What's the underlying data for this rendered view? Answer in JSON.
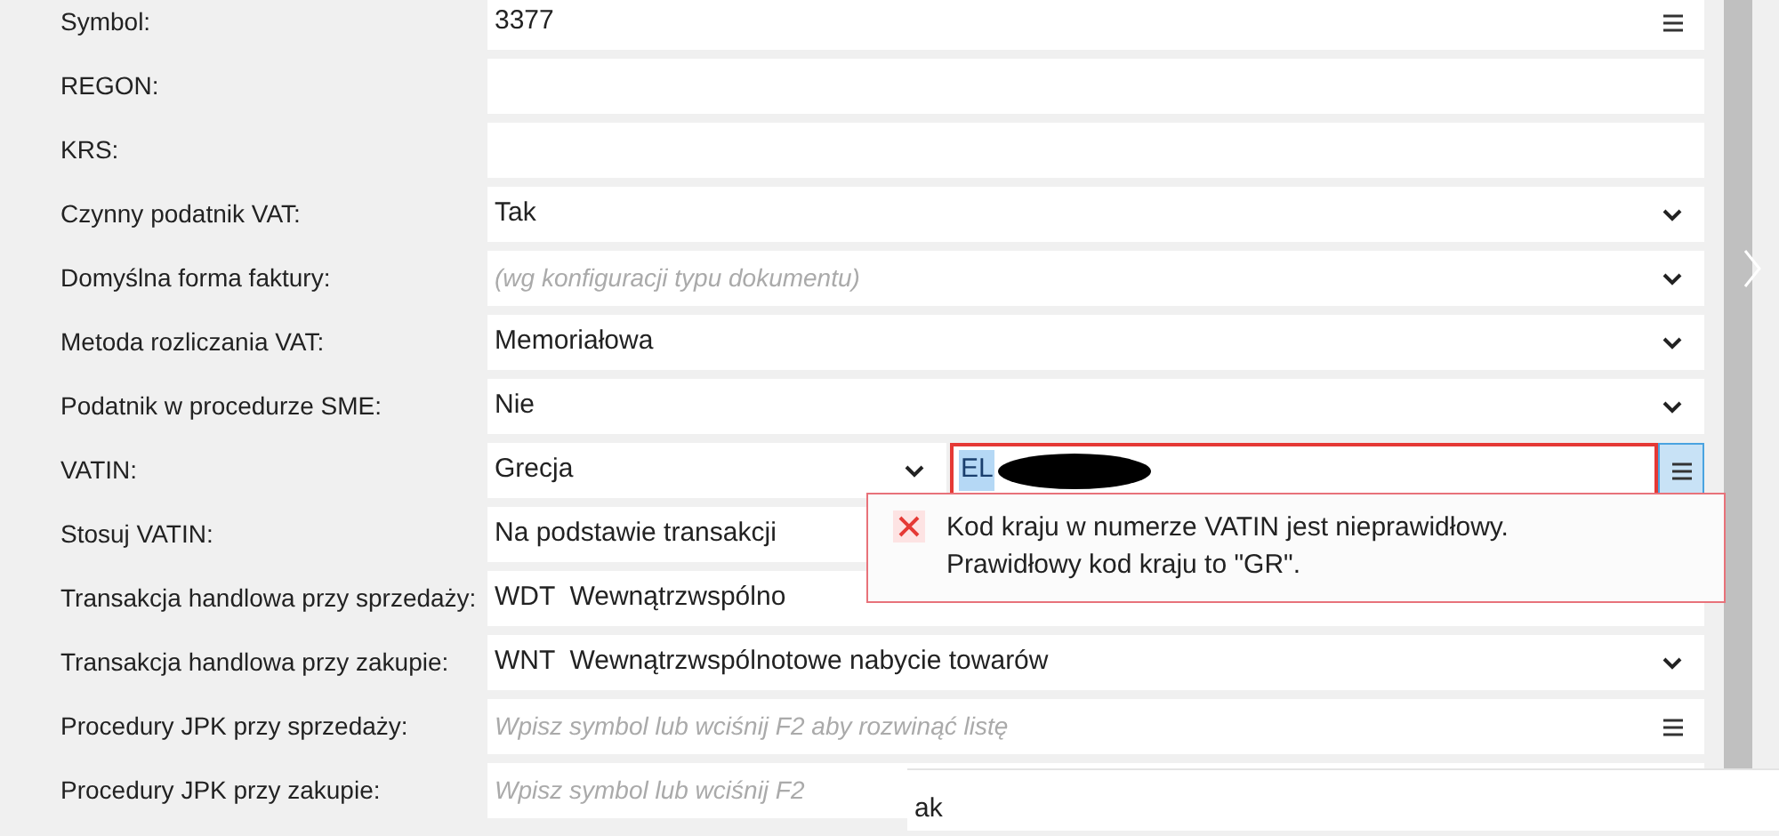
{
  "fields": [
    {
      "label": "Symbol:",
      "kind": "lookup",
      "value": "3377"
    },
    {
      "label": "REGON:",
      "kind": "text"
    },
    {
      "label": "KRS:",
      "kind": "text"
    },
    {
      "label": "Czynny podatnik VAT:",
      "kind": "select",
      "value": "Tak"
    },
    {
      "label": "Domyślna forma faktury:",
      "kind": "select",
      "placeholder": "(wg konfiguracji typu dokumentu)"
    },
    {
      "label": "Metoda rozliczania VAT:",
      "kind": "select",
      "value": "Memoriałowa"
    },
    {
      "label": "Podatnik w procedurze SME:",
      "kind": "select",
      "value": "Nie"
    },
    {
      "label": "VATIN:",
      "kind": "vatin",
      "country": "Grecja",
      "value": "EL",
      "invalid": true,
      "highlighted": true
    },
    {
      "label": "Stosuj VATIN:",
      "kind": "text",
      "value": "Na podstawie transakcji"
    },
    {
      "label": "Transakcja handlowa przy sprzedaży:",
      "kind": "text",
      "value": "WDT  Wewnątrzwspólno"
    },
    {
      "label": "Transakcja handlowa przy zakupie:",
      "kind": "select",
      "value": "WNT  Wewnątrzwspólnotowe nabycie towarów"
    },
    {
      "label": "Procedury JPK przy sprzedaży:",
      "kind": "lookup",
      "placeholder": "Wpisz symbol lub wciśnij F2 aby rozwinąć listę"
    },
    {
      "label": "Procedury JPK przy zakupie:",
      "kind": "text",
      "placeholder": "Wpisz symbol lub wciśnij F2"
    }
  ],
  "error_tooltip": {
    "lines": [
      "Kod kraju w numerze VATIN jest nieprawidłowy.",
      "Prawidłowy kod kraju to \"GR\"."
    ]
  },
  "bottom_panel": {
    "text": "ak"
  }
}
